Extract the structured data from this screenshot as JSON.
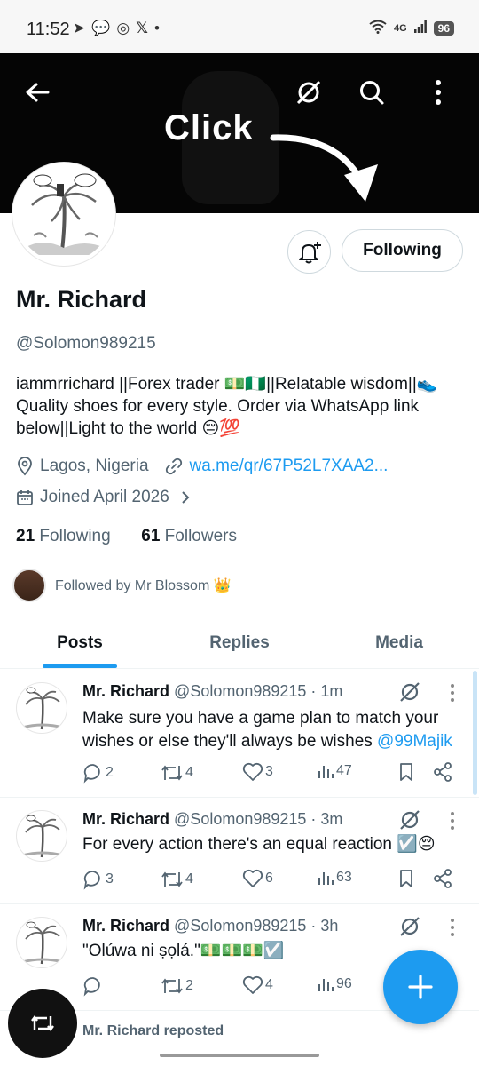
{
  "status_bar": {
    "time": "11:52",
    "left_icons": [
      "telegram-icon",
      "chat-icon",
      "whatsapp-icon",
      "x-icon",
      "dot-icon"
    ],
    "network": "4G",
    "battery": "96"
  },
  "banner": {
    "text": "Click"
  },
  "profile": {
    "name": "Mr. Richard",
    "handle": "@Solomon989215",
    "bio": "iammrrichard ||Forex trader 💵🇳🇬||Relatable wisdom||👟 Quality shoes for every style. Order via WhatsApp link below||Light to the world 😔💯",
    "location": "Lagos, Nigeria",
    "website": "wa.me/qr/67P52L7XAA2...",
    "joined": "Joined April 2026",
    "following_count": "21",
    "following_label": "Following",
    "followers_count": "61",
    "followers_label": "Followers",
    "followed_by": "Followed by Mr Blossom 👑",
    "follow_button": "Following"
  },
  "tabs": [
    {
      "label": "Posts",
      "active": true
    },
    {
      "label": "Replies",
      "active": false
    },
    {
      "label": "Media",
      "active": false
    }
  ],
  "posts": [
    {
      "name": "Mr. Richard",
      "meta": "@Solomon989215 · 1m",
      "text": "Make sure you have a game plan to match your wishes or else they'll always be wishes ",
      "mention": "@99Majik",
      "replies": "2",
      "reposts": "4",
      "likes": "3",
      "views": "47"
    },
    {
      "name": "Mr. Richard",
      "meta": "@Solomon989215 · 3m",
      "text": "For every action there's an equal reaction ☑️😔",
      "mention": "",
      "replies": "3",
      "reposts": "4",
      "likes": "6",
      "views": "63"
    },
    {
      "name": "Mr. Richard",
      "meta": "@Solomon989215 · 3h",
      "text": "\"Olúwa ni ṣọlá.\"💵💵💵☑️",
      "mention": "",
      "replies": "",
      "reposts": "2",
      "likes": "4",
      "views": "96"
    }
  ],
  "reposted_line": "Mr. Richard reposted",
  "colors": {
    "accent": "#1d9bf0",
    "text_primary": "#0f1419",
    "text_secondary": "#536471"
  }
}
